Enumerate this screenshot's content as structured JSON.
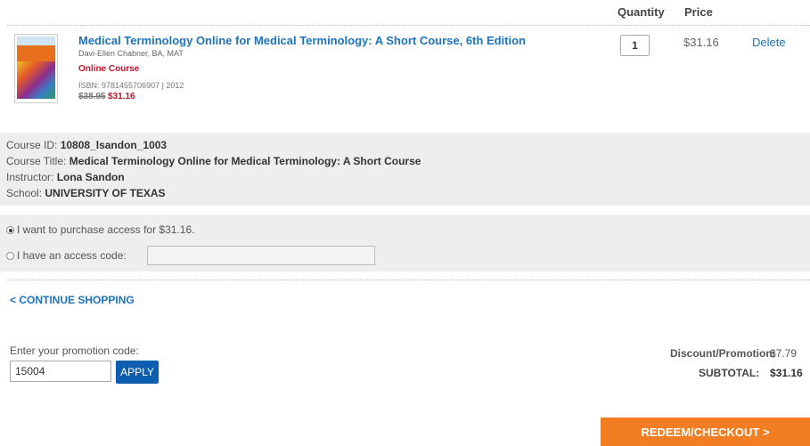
{
  "cart": {
    "headers": {
      "quantity": "Quantity",
      "price": "Price"
    },
    "item": {
      "title": "Medical Terminology Online for Medical Terminology: A Short Course, 6th Edition",
      "author": "Davi-Ellen Chabner, BA, MAT",
      "type": "Online Course",
      "isbn_line": "ISBN: 9781455706907  |  2012",
      "old_price": "$38.95",
      "new_price": "$31.16",
      "quantity": "1",
      "price": "$31.16",
      "delete_label": "Delete"
    }
  },
  "course": {
    "id_label": "Course ID: ",
    "id_value": "10808_lsandon_1003",
    "title_label": "Course Title: ",
    "title_value": "Medical Terminology Online for Medical Terminology: A Short Course",
    "instructor_label": "Instructor: ",
    "instructor_value": "Lona Sandon",
    "school_label": "School: ",
    "school_value": "UNIVERSITY OF TEXAS"
  },
  "access": {
    "purchase_label": "I want to purchase access for $31.16.",
    "code_label": "I have an access code:",
    "code_value": "",
    "selected": "purchase"
  },
  "continue_label": "< CONTINUE SHOPPING",
  "promo": {
    "label": "Enter your promotion code:",
    "value": "15004",
    "apply_label": "APPLY"
  },
  "totals": {
    "discount_label": "Discount/Promotion:",
    "discount_value": "$7.79",
    "subtotal_label": "SUBTOTAL:",
    "subtotal_value": "$31.16"
  },
  "checkout_label": "REDEEM/CHECKOUT >",
  "colors": {
    "link": "#1e73be",
    "sale": "#c0142a",
    "apply": "#0d5eaf",
    "checkout": "#f37d22"
  }
}
